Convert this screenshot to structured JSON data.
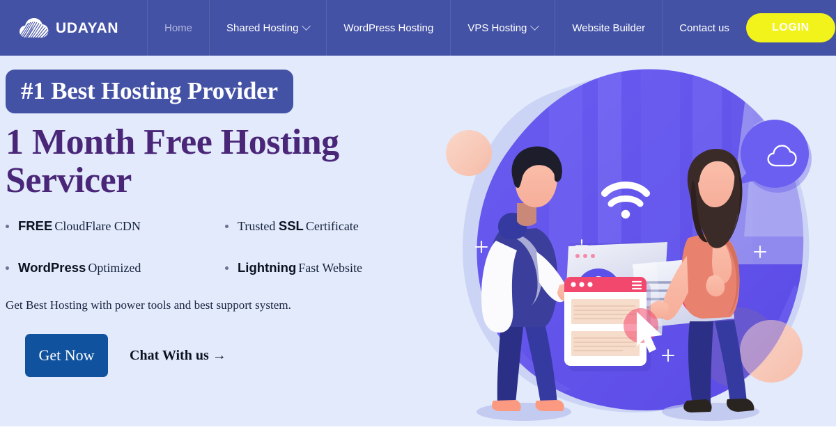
{
  "brand": {
    "name": "UDAYAN",
    "logo_icon": "cloud-striped-logo-icon"
  },
  "nav": {
    "items": [
      {
        "label": "Home",
        "active": true,
        "has_caret": false,
        "icon": ""
      },
      {
        "label": "Shared Hosting",
        "active": false,
        "has_caret": true,
        "icon": "chevron-down-icon"
      },
      {
        "label": "WordPress Hosting",
        "active": false,
        "has_caret": false,
        "icon": ""
      },
      {
        "label": "VPS Hosting",
        "active": false,
        "has_caret": true,
        "icon": "chevron-down-icon"
      },
      {
        "label": "Website Builder",
        "active": false,
        "has_caret": false,
        "icon": ""
      },
      {
        "label": "Contact us",
        "active": false,
        "has_caret": false,
        "icon": ""
      }
    ],
    "login_label": "LOGIN"
  },
  "hero": {
    "badge": "#1 Best Hosting Provider",
    "title_line1": "1 Month Free Hosting",
    "title_line2": "Servicer",
    "features": [
      {
        "strong": "FREE",
        "rest": "CloudFlare CDN",
        "lead": ""
      },
      {
        "strong": "SSL",
        "rest": "Certificate",
        "lead": "Trusted"
      },
      {
        "strong": "WordPress",
        "rest": "Optimized",
        "lead": ""
      },
      {
        "strong": "Lightning",
        "rest": "Fast Website",
        "lead": ""
      }
    ],
    "description": "Get Best Hosting with power tools and best support system.",
    "cta_primary": "Get Now",
    "cta_secondary": "Chat With us →",
    "illustration_alt": "two-people-web-hosting-illustration"
  },
  "colors": {
    "nav_bg": "#4452A6",
    "page_bg": "#E2EAFB",
    "accent_yellow": "#F2F31B",
    "badge_bg": "#4452A6",
    "title_purple": "#4A2678",
    "cta_blue": "#11529F",
    "blob_purple": "#5B51E8",
    "blob_light": "#B7BDF0",
    "peach": "#FBC7B4",
    "pink": "#F2486E"
  }
}
